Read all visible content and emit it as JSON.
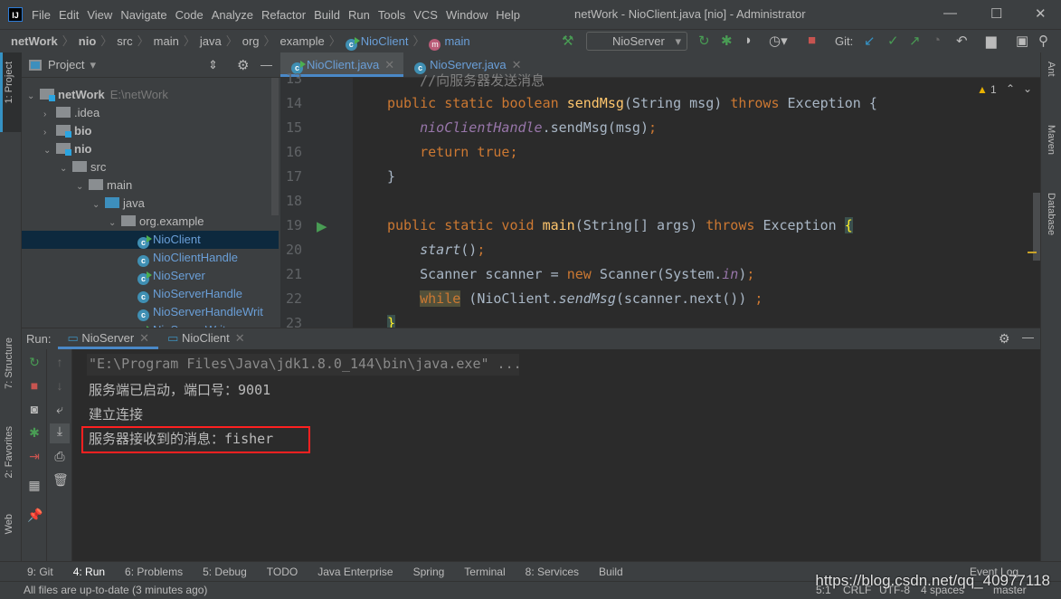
{
  "window": {
    "title": "netWork - NioClient.java [nio] - Administrator",
    "menu": [
      "File",
      "Edit",
      "View",
      "Navigate",
      "Code",
      "Analyze",
      "Refactor",
      "Build",
      "Run",
      "Tools",
      "VCS",
      "Window",
      "Help"
    ]
  },
  "breadcrumb": [
    "netWork",
    "nio",
    "src",
    "main",
    "java",
    "org",
    "example",
    "NioClient",
    "main"
  ],
  "toolbar": {
    "run_config": "NioServer",
    "git_label": "Git:",
    "colors": {
      "green": "#499c54",
      "red": "#c75450",
      "blue": "#3592c4"
    }
  },
  "left_strip": {
    "project": "1: Project",
    "structure": "7: Structure",
    "favorites": "2: Favorites",
    "web": "Web"
  },
  "right_strip": {
    "ant": "Ant",
    "maven": "Maven",
    "database": "Database"
  },
  "project": {
    "title": "Project",
    "tree": [
      {
        "label": "netWork",
        "extra": "E:\\netWork",
        "depth": 0,
        "type": "module",
        "open": true,
        "bold": true
      },
      {
        "label": ".idea",
        "depth": 1,
        "type": "folder",
        "open": false
      },
      {
        "label": "bio",
        "depth": 1,
        "type": "module",
        "open": false,
        "bold": true
      },
      {
        "label": "nio",
        "depth": 1,
        "type": "module",
        "open": true,
        "bold": true
      },
      {
        "label": "src",
        "depth": 2,
        "type": "folder",
        "open": true
      },
      {
        "label": "main",
        "depth": 3,
        "type": "folder",
        "open": true
      },
      {
        "label": "java",
        "depth": 4,
        "type": "source",
        "open": true
      },
      {
        "label": "org.example",
        "depth": 5,
        "type": "package",
        "open": true
      },
      {
        "label": "NioClient",
        "depth": 6,
        "type": "class-run",
        "selected": true
      },
      {
        "label": "NioClientHandle",
        "depth": 6,
        "type": "class"
      },
      {
        "label": "NioServer",
        "depth": 6,
        "type": "class-run"
      },
      {
        "label": "NioServerHandle",
        "depth": 6,
        "type": "class"
      },
      {
        "label": "NioServerHandleWrit",
        "depth": 6,
        "type": "class"
      },
      {
        "label": "NioServerWrite",
        "depth": 6,
        "type": "class-run"
      }
    ]
  },
  "editor": {
    "tabs": [
      {
        "label": "NioClient.java",
        "active": true
      },
      {
        "label": "NioServer.java",
        "active": false
      }
    ],
    "warnings": "1",
    "lines": [
      {
        "n": "13",
        "tokens": [
          [
            "    //向服务器发送消息",
            "cm"
          ]
        ]
      },
      {
        "n": "14",
        "tokens": [
          [
            "public static boolean ",
            "kw"
          ],
          [
            "sendMsg",
            "fn"
          ],
          [
            "(String msg) ",
            ""
          ],
          [
            "throws ",
            "kw"
          ],
          [
            "Exception {",
            ""
          ]
        ]
      },
      {
        "n": "15",
        "tokens": [
          [
            "    ",
            ""
          ],
          [
            "nioClientHandle",
            "fld"
          ],
          [
            ".sendMsg(msg)",
            ""
          ],
          [
            ";",
            "kw"
          ]
        ]
      },
      {
        "n": "16",
        "tokens": [
          [
            "    return true;",
            "kw"
          ]
        ]
      },
      {
        "n": "17",
        "tokens": [
          [
            "}",
            ""
          ]
        ]
      },
      {
        "n": "18",
        "tokens": []
      },
      {
        "n": "19",
        "tokens": [
          [
            "public static void ",
            "kw"
          ],
          [
            "main",
            "fn"
          ],
          [
            "(String[] args) ",
            ""
          ],
          [
            "throws ",
            "kw"
          ],
          [
            "Exception ",
            ""
          ],
          [
            "{",
            "br"
          ]
        ]
      },
      {
        "n": "20",
        "tokens": [
          [
            "    ",
            ""
          ],
          [
            "start",
            "it"
          ],
          [
            "()",
            ""
          ],
          [
            ";",
            "kw"
          ]
        ]
      },
      {
        "n": "21",
        "tokens": [
          [
            "    Scanner scanner = ",
            ""
          ],
          [
            "new ",
            "kw"
          ],
          [
            "Scanner(System.",
            ""
          ],
          [
            "in",
            "fld"
          ],
          [
            ")",
            ""
          ],
          [
            ";",
            "kw"
          ]
        ]
      },
      {
        "n": "22",
        "tokens": [
          [
            "    ",
            ""
          ],
          [
            "while",
            "kw hl"
          ],
          [
            " (NioClient.",
            ""
          ],
          [
            "sendMsg",
            "it"
          ],
          [
            "(scanner.next()) ",
            ""
          ],
          [
            ";",
            "kw"
          ]
        ]
      },
      {
        "n": "23",
        "tokens": [
          [
            "}",
            "br"
          ]
        ]
      }
    ]
  },
  "run": {
    "label": "Run:",
    "tabs": [
      {
        "label": "NioServer",
        "active": true
      },
      {
        "label": "NioClient",
        "active": false
      }
    ],
    "output": [
      "\"E:\\Program Files\\Java\\jdk1.8.0_144\\bin\\java.exe\" ...",
      "服务端已启动，端口号：9001",
      "建立连接",
      "服务器接收到的消息：fisher"
    ]
  },
  "bottom_tools": [
    {
      "key": "9",
      "label": "9: Git"
    },
    {
      "key": "4",
      "label": "4: Run"
    },
    {
      "key": "6",
      "label": "6: Problems"
    },
    {
      "key": "5",
      "label": "5: Debug"
    },
    {
      "label": "TODO"
    },
    {
      "label": "Java Enterprise"
    },
    {
      "label": "Spring"
    },
    {
      "label": "Terminal"
    },
    {
      "label": "8: Services"
    },
    {
      "label": "Build"
    }
  ],
  "event_log": "Event Log",
  "status": {
    "message": "All files are up-to-date (3 minutes ago)",
    "position": "5:1",
    "line_sep": "CRLF",
    "encoding": "UTF-8",
    "indent": "4 spaces",
    "branch": "master"
  },
  "watermark": "https://blog.csdn.net/qq_40977118"
}
